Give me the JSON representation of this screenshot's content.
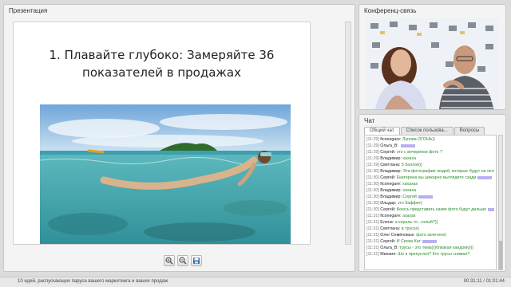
{
  "presentation": {
    "panel_title": "Презентация",
    "slide_title": "1. Плавайте глубоко: Замеряйте 36 показателей в продажах",
    "toolbar": {
      "zoom_in_icon": "zoom-in-icon",
      "zoom_out_icon": "zoom-out-icon",
      "save_icon": "save-icon"
    }
  },
  "conference": {
    "panel_title": "Конференц-связь"
  },
  "chat": {
    "panel_title": "Чат",
    "tabs": [
      "Общий чат",
      "Список пользова...",
      "Вопросы"
    ],
    "messages": [
      {
        "time": "[11:29]",
        "name": "ficonegare:",
        "text": "Лупова ОГОНЬ))"
      },
      {
        "time": "[11:29]",
        "name": "Ольга_В:",
        "text": "",
        "smile": true
      },
      {
        "time": "[11:29]",
        "name": "Сергей:",
        "text": "это с вечеринки фото ?"
      },
      {
        "time": "[11:29]",
        "name": "Владимир:",
        "text": "хахаха"
      },
      {
        "time": "[11:29]",
        "name": "Светлана:",
        "text": "5 баллов))"
      },
      {
        "time": "[11:30]",
        "name": "Владимир:",
        "text": "Эта фотография людей, которые будут на яхте)"
      },
      {
        "time": "[11:30]",
        "name": "Сергей:",
        "text": "Екатерина вы шикарно выглядите сзади",
        "smile": true
      },
      {
        "time": "[11:30]",
        "name": "ficonegare:",
        "text": "хахахах"
      },
      {
        "time": "[11:30]",
        "name": "Владимир:",
        "text": "хахаха"
      },
      {
        "time": "[11:30]",
        "name": "Владимир:",
        "text": "Сергей",
        "smile": true
      },
      {
        "time": "[11:30]",
        "name": "Ильдар:",
        "text": "это баффет)"
      },
      {
        "time": "[11:30]",
        "name": "Сергей:",
        "text": "Боюсь представить какие фото будут дальше",
        "smile": true
      },
      {
        "time": "[11:31]",
        "name": "ficonegare:",
        "text": "ахахах"
      },
      {
        "time": "[11:31]",
        "name": "Елена:",
        "text": "а кораль то...голый?))"
      },
      {
        "time": "[11:31]",
        "name": "Светлана:",
        "text": "в трусах)"
      },
      {
        "time": "[11:31]",
        "name": "Олег Семёновых:",
        "text": "фото зачетное)"
      },
      {
        "time": "[11:31]",
        "name": "Сергей:",
        "text": "И Сисва Кат",
        "smile": true
      },
      {
        "time": "[11:31]",
        "name": "Ольга_В:",
        "text": "трусы - это тема)))близкая кандому)))"
      },
      {
        "time": "[11:31]",
        "name": "Михаил:",
        "text": "Шо я пропустил? Кто трусы снимал?"
      }
    ]
  },
  "status": {
    "title": "10 идей, распускающих паруса вашего маркетинга и ваших продаж",
    "time": "00:31:11 / 01:01:44"
  },
  "colors": {
    "panel_bg": "#f4f4f4",
    "message_text": "#2a8a2a",
    "emoticon": "#b8b0f0"
  }
}
